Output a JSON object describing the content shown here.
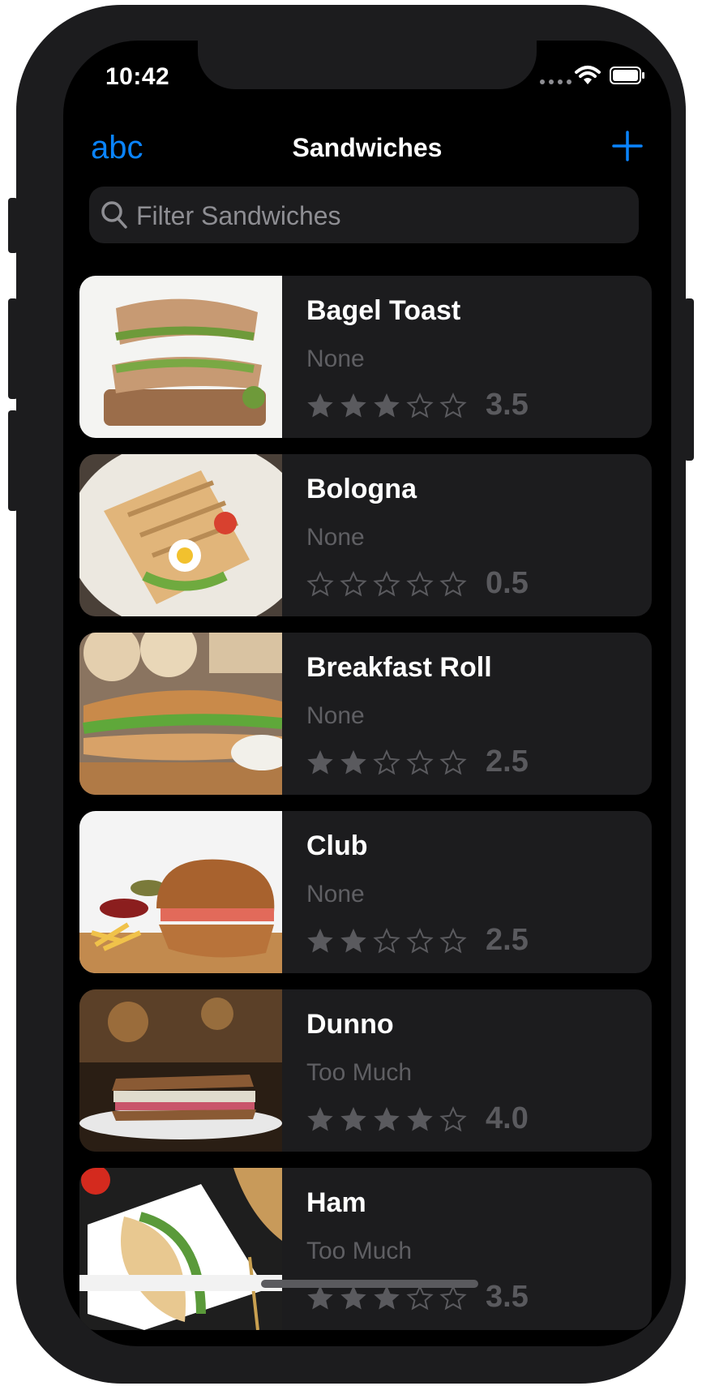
{
  "status_bar": {
    "time": "10:42"
  },
  "nav": {
    "left_button": "abc",
    "title": "Sandwiches",
    "add_icon": "plus-icon"
  },
  "search": {
    "placeholder": "Filter Sandwiches",
    "value": "",
    "icon": "magnifying-glass-icon"
  },
  "colors": {
    "accent": "#0a84ff",
    "background": "#000000",
    "card": "#1c1c1e",
    "muted": "#5f5f63"
  },
  "sandwiches": [
    {
      "name": "Bagel Toast",
      "detail": "None",
      "rating": 3.5,
      "rating_text": "3.5"
    },
    {
      "name": "Bologna",
      "detail": "None",
      "rating": 0.5,
      "rating_text": "0.5"
    },
    {
      "name": "Breakfast Roll",
      "detail": "None",
      "rating": 2.5,
      "rating_text": "2.5"
    },
    {
      "name": "Club",
      "detail": "None",
      "rating": 2.5,
      "rating_text": "2.5"
    },
    {
      "name": "Dunno",
      "detail": "Too Much",
      "rating": 4.0,
      "rating_text": "4.0"
    },
    {
      "name": "Ham",
      "detail": "Too Much",
      "rating": 3.5,
      "rating_text": "3.5"
    }
  ]
}
